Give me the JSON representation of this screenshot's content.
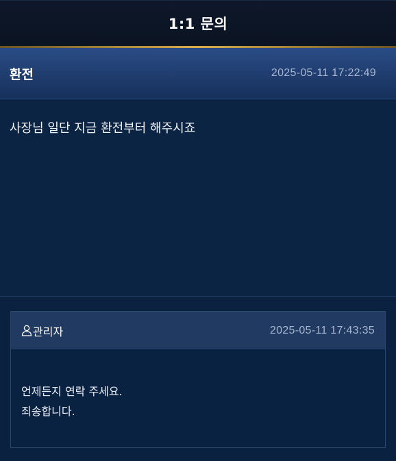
{
  "header": {
    "title": "1:1 문의"
  },
  "inquiry": {
    "subject": "환전",
    "date": "2025-05-11 17:22:49",
    "body": "사장님 일단 지금 환전부터 해주시죠"
  },
  "reply": {
    "author": "관리자",
    "author_icon": "person-icon",
    "date": "2025-05-11 17:43:35",
    "lines": [
      "언제든지 연락 주세요.",
      "죄송합니다."
    ]
  },
  "colors": {
    "header_bg": "#0e1729",
    "accent_gold": "#d8ad4e",
    "subject_bar": "#2a4c86",
    "content_bg": "#0b2444"
  }
}
